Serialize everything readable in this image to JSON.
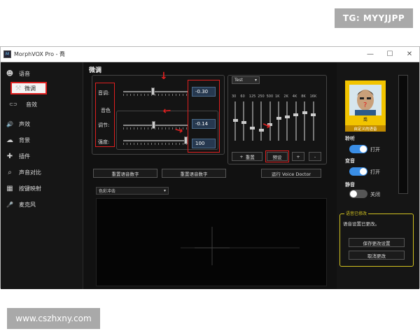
{
  "watermarks": {
    "top": "TG: MYYJJPP",
    "bottom": "www.cszhxny.com"
  },
  "window": {
    "app_title": "MorphVOX Pro - 喬",
    "minimize": "—",
    "maximize": "☐",
    "close": "✕"
  },
  "sidebar": {
    "items": [
      {
        "label": "语音",
        "icon": "person-icon",
        "glyph": "☻"
      },
      {
        "label": "微调",
        "icon": "tools-icon",
        "glyph": "⚒"
      },
      {
        "label": "音效",
        "icon": "effects-icon",
        "glyph": "⊂⊃"
      },
      {
        "label": "声效",
        "icon": "speaker-icon",
        "glyph": "🔊"
      },
      {
        "label": "背景",
        "icon": "cloud-icon",
        "glyph": "☁"
      },
      {
        "label": "插件",
        "icon": "plugin-icon",
        "glyph": "✚"
      },
      {
        "label": "声音对比",
        "icon": "compare-icon",
        "glyph": "⌕"
      },
      {
        "label": "按键映射",
        "icon": "keyboard-icon",
        "glyph": "▦"
      },
      {
        "label": "麦克风",
        "icon": "microphone-icon",
        "glyph": "🎤"
      }
    ]
  },
  "tweak": {
    "section_title": "微调",
    "pitch_label": "音调:",
    "timbre_group_label": "音色",
    "timbre_adjust_label": "调节:",
    "strength_label": "强度:",
    "pitch_value": "-0.30",
    "timbre_value": "-0.14",
    "strength_value": "100",
    "pitch_level": 0.46,
    "timbre_level": 0.47,
    "strength_level": 1.0,
    "reset_voice_button": "重置语音数字",
    "restore_voice_button": "重置语音数字",
    "voice_doctor_button": "运行 Voice Doctor"
  },
  "equalizer": {
    "preset": "Test",
    "frequencies": [
      "30",
      "60",
      "125",
      "250",
      "500",
      "1K",
      "2K",
      "4K",
      "8K",
      "16K"
    ],
    "levels": [
      0.55,
      0.5,
      0.35,
      0.3,
      0.45,
      0.6,
      0.65,
      0.7,
      0.75,
      0.7
    ],
    "reset_button": "重置",
    "preset_button": "预设",
    "add_button": "+",
    "remove_button": "-"
  },
  "visualizer": {
    "mode": "色彩冲击"
  },
  "right_panel": {
    "avatar_name": "喬",
    "avatar_tag": "自定义的语音",
    "listen_label": "聆听",
    "listen_state": "打开",
    "morph_label": "变音",
    "morph_state": "打开",
    "mute_label": "静音",
    "mute_state": "关闭",
    "voice_changed_title": "语音已修改",
    "voice_changed_status": "语音设置已更改。",
    "save_button": "保存更改设置",
    "cancel_button": "取消更改"
  },
  "colors": {
    "accent_red": "#e02020",
    "toggle_on": "#3a8ee6",
    "toggle_off": "#555555",
    "avatar_frame": "#f2c400"
  }
}
